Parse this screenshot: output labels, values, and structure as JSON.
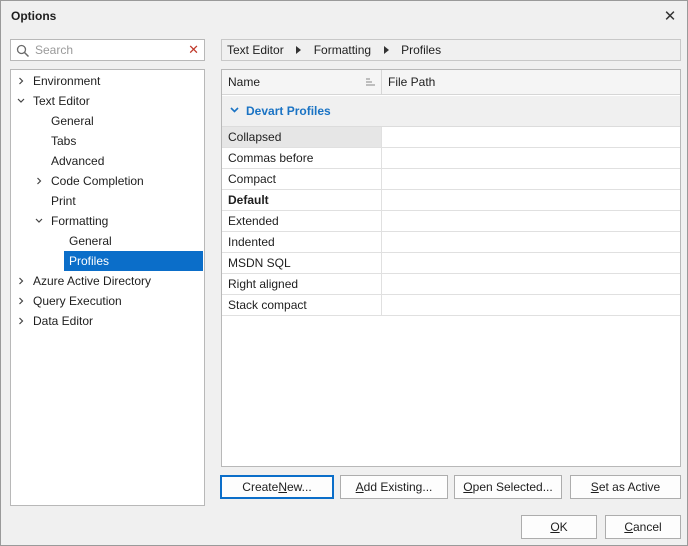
{
  "window": {
    "title": "Options"
  },
  "search": {
    "placeholder": "Search",
    "value": ""
  },
  "tree": [
    {
      "label": "Environment",
      "indent": 0,
      "expander": "collapsed"
    },
    {
      "label": "Text Editor",
      "indent": 0,
      "expander": "expanded"
    },
    {
      "label": "General",
      "indent": 1,
      "expander": "none"
    },
    {
      "label": "Tabs",
      "indent": 1,
      "expander": "none"
    },
    {
      "label": "Advanced",
      "indent": 1,
      "expander": "none"
    },
    {
      "label": "Code Completion",
      "indent": 1,
      "expander": "collapsed"
    },
    {
      "label": "Print",
      "indent": 1,
      "expander": "none"
    },
    {
      "label": "Formatting",
      "indent": 1,
      "expander": "expanded"
    },
    {
      "label": "General",
      "indent": 2,
      "expander": "none"
    },
    {
      "label": "Profiles",
      "indent": 2,
      "expander": "none",
      "selected": true
    },
    {
      "label": "Azure Active Directory",
      "indent": 0,
      "expander": "collapsed"
    },
    {
      "label": "Query Execution",
      "indent": 0,
      "expander": "collapsed"
    },
    {
      "label": "Data Editor",
      "indent": 0,
      "expander": "collapsed"
    }
  ],
  "breadcrumb": [
    "Text Editor",
    "Formatting",
    "Profiles"
  ],
  "grid": {
    "columns": {
      "name": "Name",
      "path": "File Path"
    },
    "group": "Devart Profiles",
    "rows": [
      {
        "name": "Collapsed",
        "path": "",
        "focused": true
      },
      {
        "name": "Commas before",
        "path": ""
      },
      {
        "name": "Compact",
        "path": ""
      },
      {
        "name": "Default",
        "path": "",
        "bold": true
      },
      {
        "name": "Extended",
        "path": ""
      },
      {
        "name": "Indented",
        "path": ""
      },
      {
        "name": "MSDN SQL",
        "path": ""
      },
      {
        "name": "Right aligned",
        "path": ""
      },
      {
        "name": "Stack compact",
        "path": ""
      }
    ]
  },
  "actions": {
    "create_new": {
      "pre": "Create ",
      "key": "N",
      "post": "ew..."
    },
    "add_existing": {
      "pre": "",
      "key": "A",
      "post": "dd Existing..."
    },
    "open_selected": {
      "pre": "",
      "key": "O",
      "post": "pen Selected..."
    },
    "set_active": {
      "pre": "",
      "key": "S",
      "post": "et as Active"
    }
  },
  "dialog": {
    "ok": {
      "pre": "",
      "key": "O",
      "post": "K"
    },
    "cancel": {
      "pre": "",
      "key": "C",
      "post": "ancel"
    }
  },
  "colors": {
    "accent": "#0b6ec9",
    "group_text": "#1a73c4",
    "clear_icon": "#c0392b"
  }
}
